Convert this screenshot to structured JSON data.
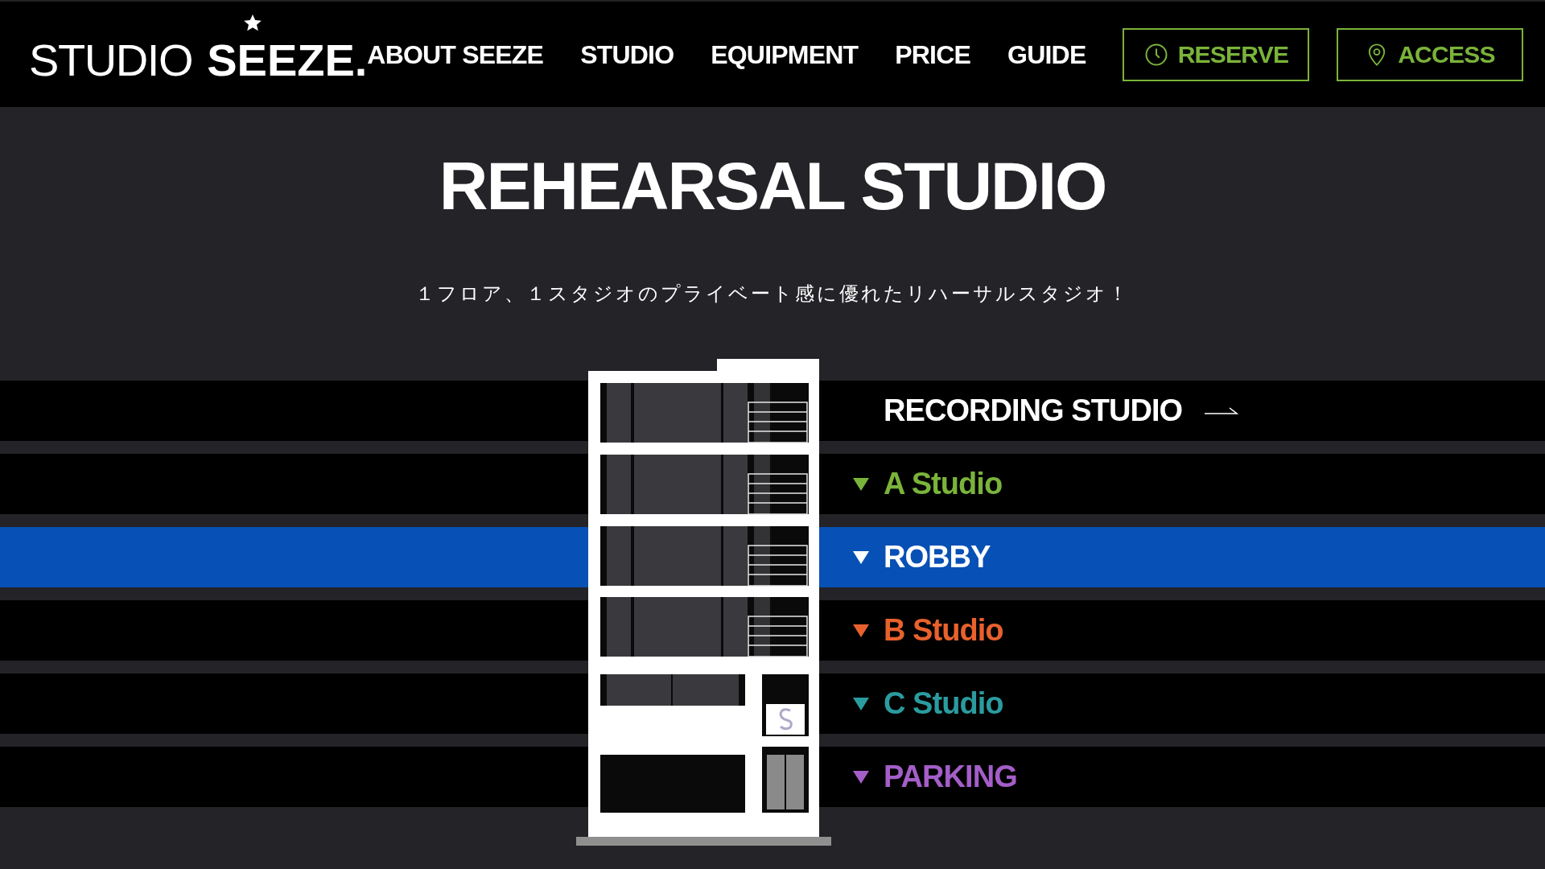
{
  "logo": {
    "light": "STUDIO",
    "bold": "SEEZE."
  },
  "nav": {
    "links": [
      "ABOUT SEEZE",
      "STUDIO",
      "EQUIPMENT",
      "PRICE",
      "GUIDE"
    ],
    "buttons": [
      {
        "label": "RESERVE",
        "kind": "clock"
      },
      {
        "label": "ACCESS",
        "kind": "pin"
      }
    ]
  },
  "title": "REHEARSAL STUDIO",
  "subtitle": "１フロア、１スタジオのプライベート感に優れたリハーサルスタジオ！",
  "floors": [
    {
      "label": "RECORDING STUDIO",
      "kind": "link",
      "selected": false
    },
    {
      "label": "A Studio",
      "kind": "floor",
      "color": "#7ab33a",
      "selected": false
    },
    {
      "label": "ROBBY",
      "kind": "floor",
      "color": "#ffffff",
      "selected": true
    },
    {
      "label": "B Studio",
      "kind": "floor",
      "color": "#e8612c",
      "selected": false
    },
    {
      "label": "C Studio",
      "kind": "floor",
      "color": "#2a9ca0",
      "selected": false
    },
    {
      "label": "PARKING",
      "kind": "floor",
      "color": "#a45ec8",
      "selected": false
    }
  ]
}
